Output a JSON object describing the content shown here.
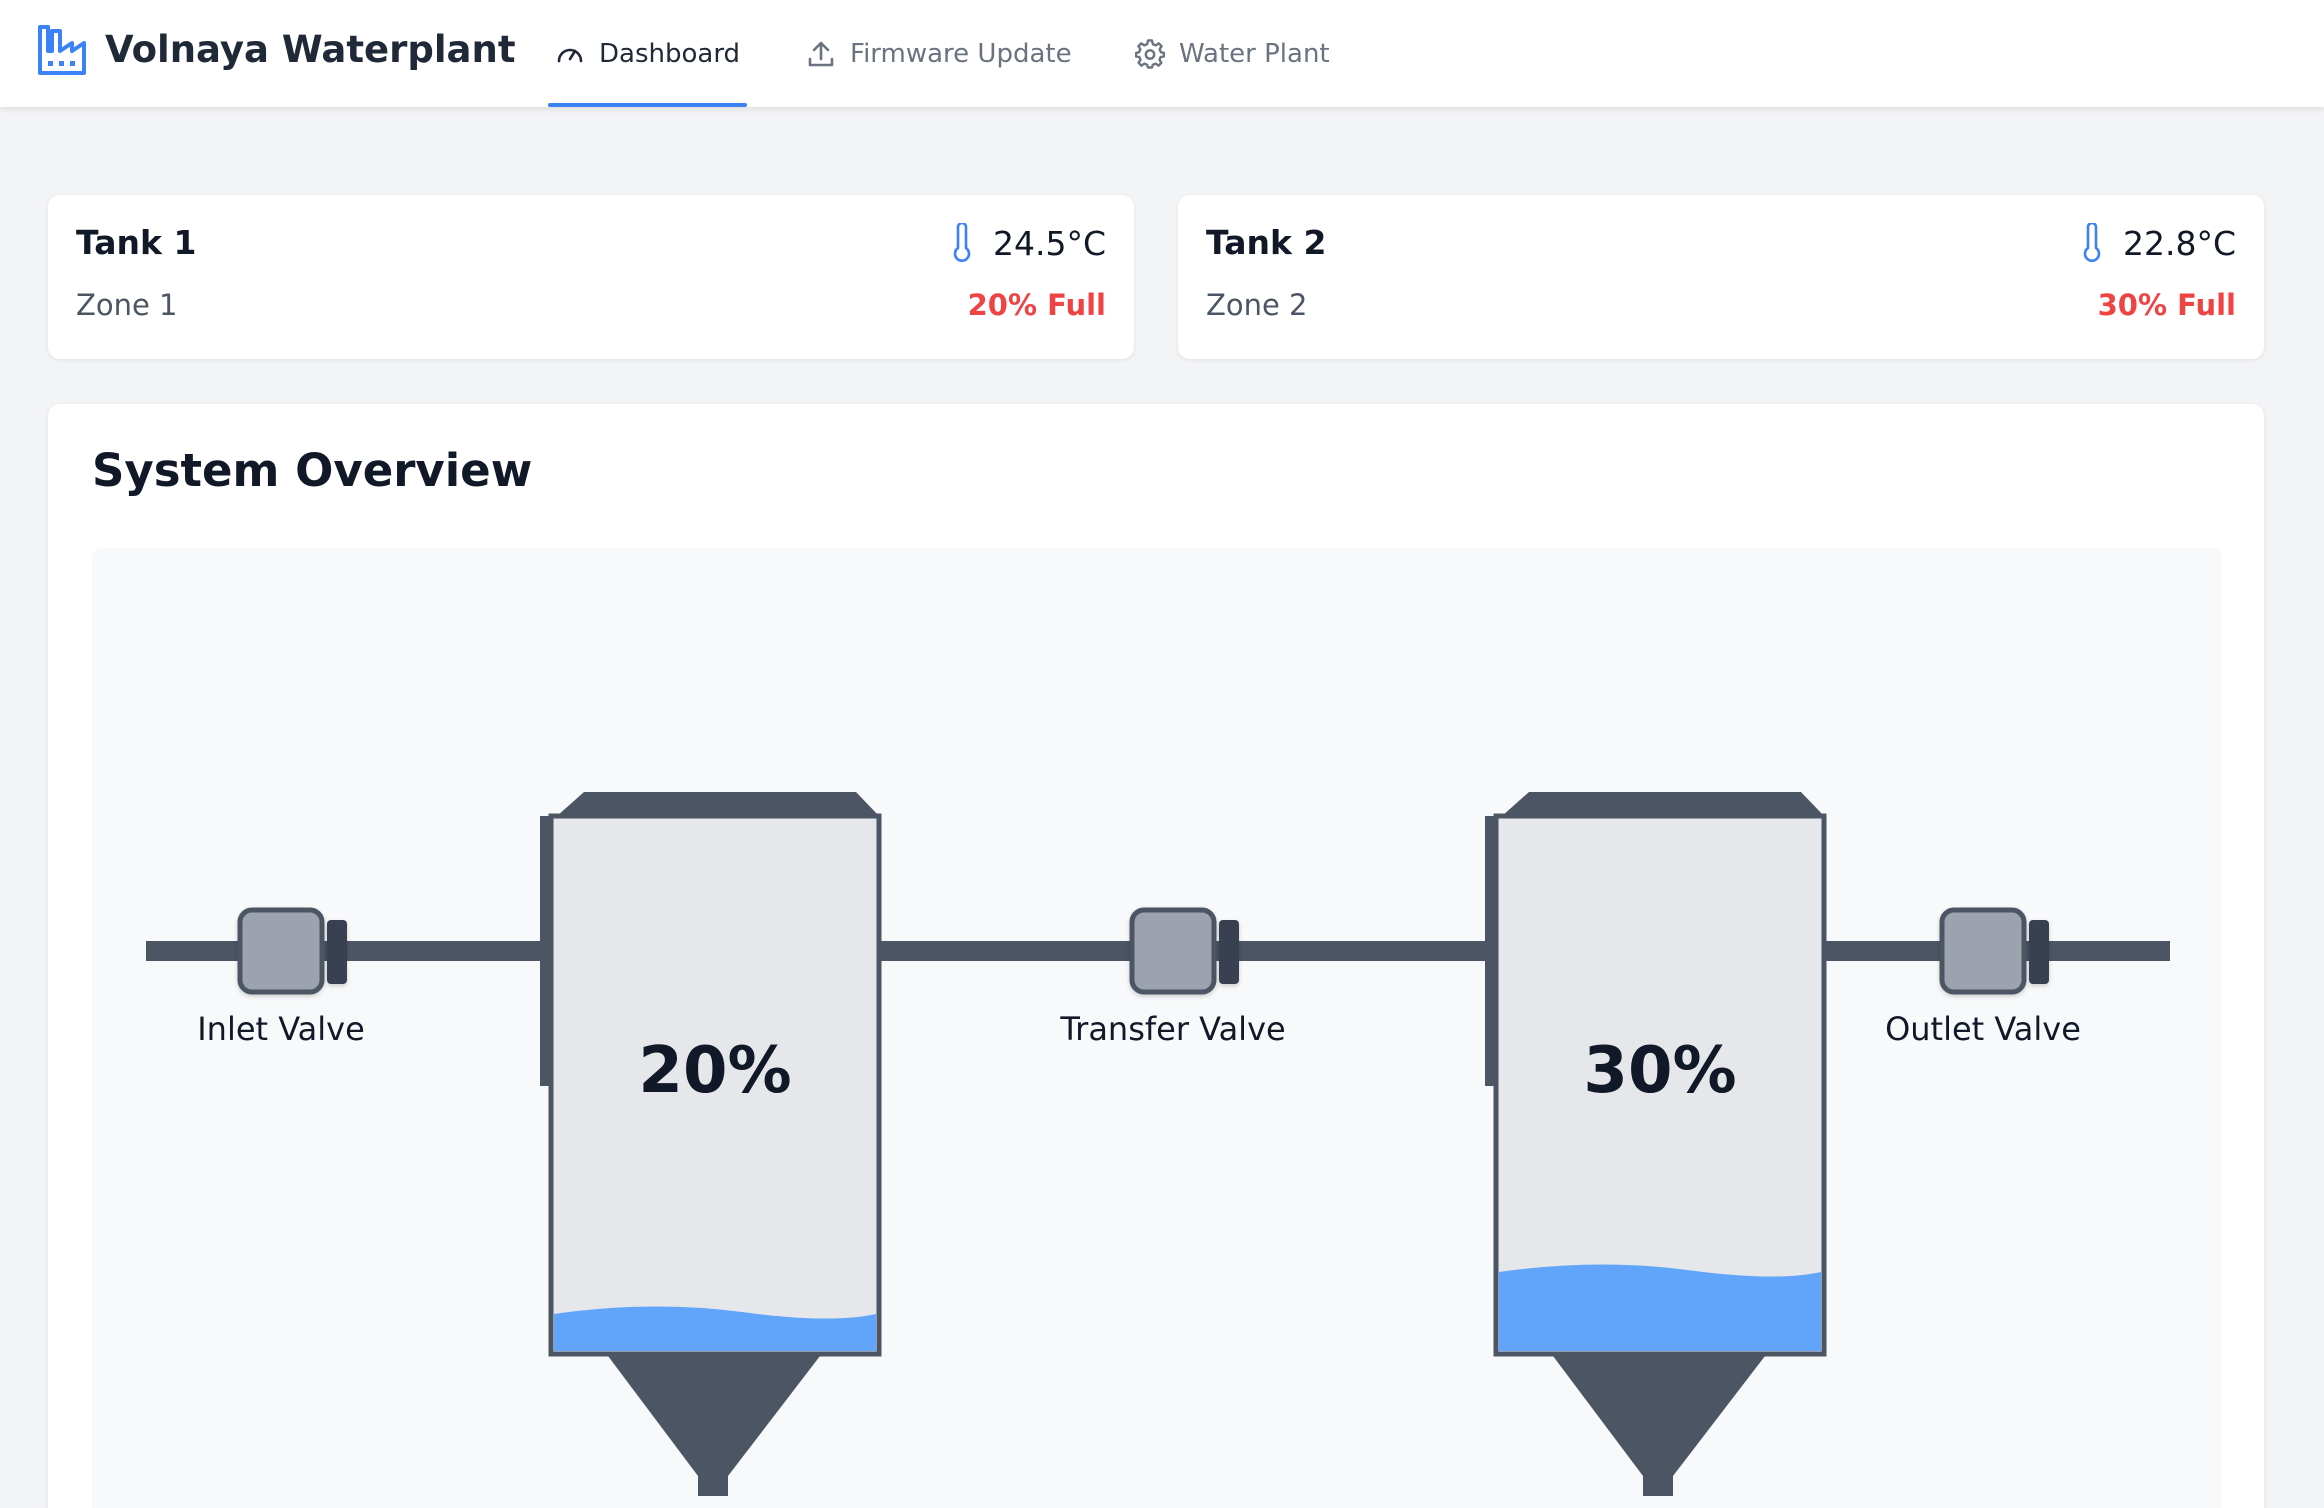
{
  "header": {
    "brand_title": "Volnaya Waterplant",
    "brand_icon": "factory-icon",
    "tabs": [
      {
        "label": "Dashboard",
        "icon": "gauge-icon",
        "active": true
      },
      {
        "label": "Firmware Update",
        "icon": "upload-icon",
        "active": false
      },
      {
        "label": "Water Plant",
        "icon": "gear-icon",
        "active": false
      }
    ]
  },
  "tanks": [
    {
      "title": "Tank 1",
      "zone": "Zone 1",
      "temperature": "24.5°C",
      "fill_label": "20% Full",
      "fill_fraction": 0.2
    },
    {
      "title": "Tank 2",
      "zone": "Zone 2",
      "temperature": "22.8°C",
      "fill_label": "30% Full",
      "fill_fraction": 0.3
    }
  ],
  "overview": {
    "title": "System Overview",
    "valves": {
      "inlet": "Inlet Valve",
      "transfer": "Transfer Valve",
      "outlet": "Outlet Valve"
    },
    "tank_levels": [
      "20%",
      "30%"
    ]
  },
  "colors": {
    "accent": "#3b82f6",
    "alert": "#ef4444",
    "water": "#60a5fa",
    "pipe": "#4b5563",
    "valve": "#9ca3af"
  }
}
